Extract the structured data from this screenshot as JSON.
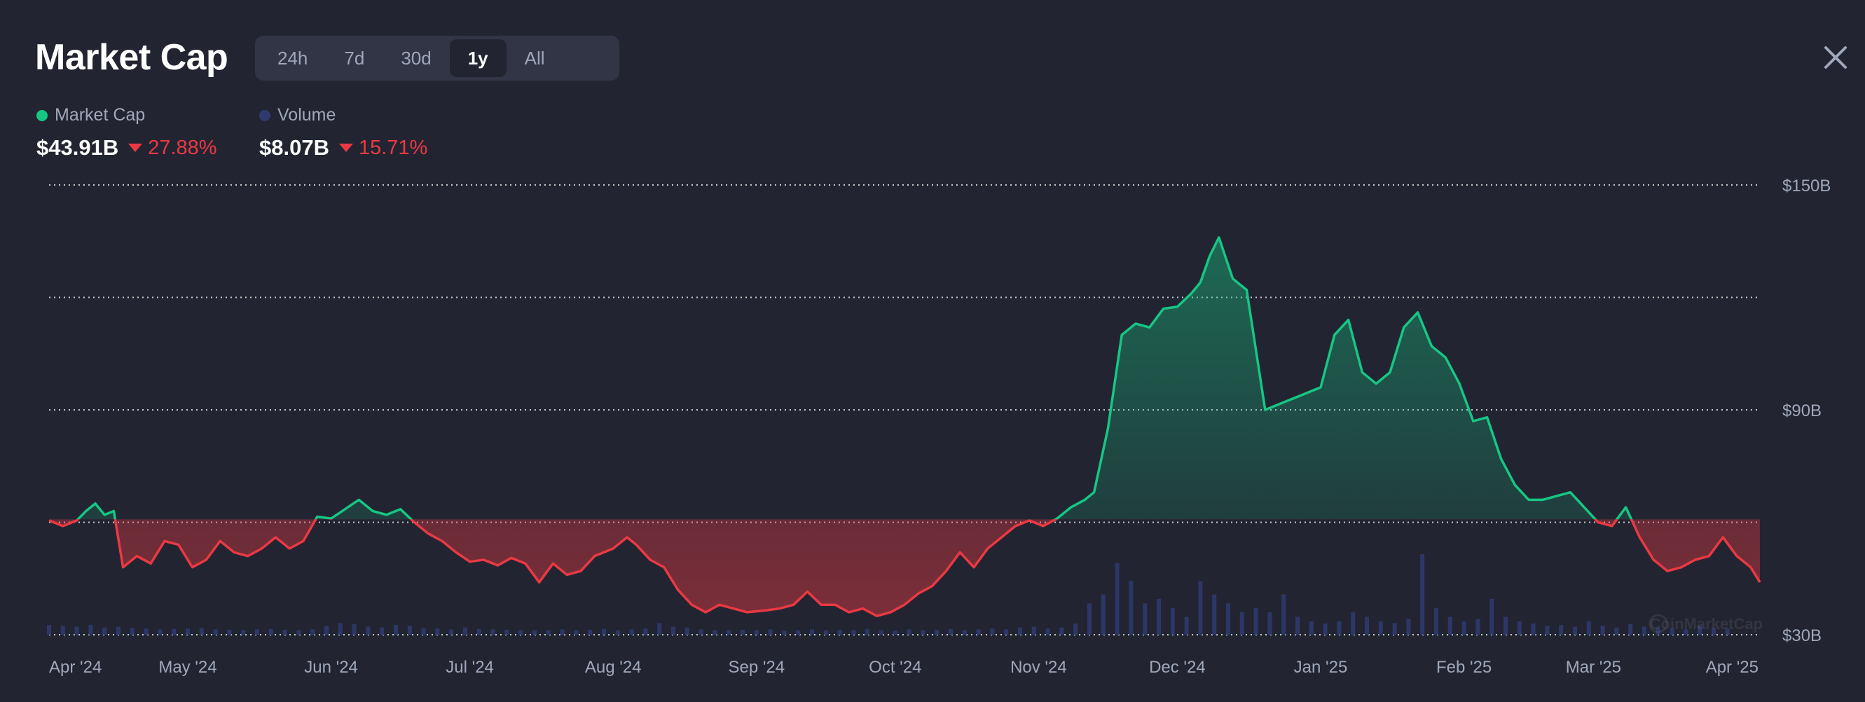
{
  "header": {
    "title": "Market Cap",
    "ranges": [
      "24h",
      "7d",
      "30d",
      "1y",
      "All"
    ],
    "active_range": "1y"
  },
  "legend": [
    {
      "label": "Market Cap",
      "color": "#16c784"
    },
    {
      "label": "Volume",
      "color": "#2f3a6e"
    }
  ],
  "stats": {
    "market_cap": {
      "value": "$43.91B",
      "change": "27.88%",
      "direction": "down"
    },
    "volume": {
      "value": "$8.07B",
      "change": "15.71%",
      "direction": "down"
    }
  },
  "colors": {
    "up": "#16c784",
    "down": "#ea3943",
    "background": "#222531",
    "volume": "#2f3a6e",
    "grid": "#ffffff"
  },
  "watermark": "CoinMarketCap",
  "chart_data": {
    "type": "area",
    "baseline": 60.8,
    "ylim": [
      30,
      150
    ],
    "yticks": [
      30,
      90,
      150
    ],
    "ytick_labels": [
      "$30B",
      "$90B",
      "$150B"
    ],
    "grid_lines": [
      30,
      60,
      90,
      120,
      150
    ],
    "x_start": "2024-04-01",
    "x_end": "2025-04-06",
    "xtick_dates": [
      "2024-04-01",
      "2024-05-01",
      "2024-06-01",
      "2024-07-01",
      "2024-08-01",
      "2024-09-01",
      "2024-10-01",
      "2024-11-01",
      "2024-12-01",
      "2025-01-01",
      "2025-02-01",
      "2025-03-01",
      "2025-04-01"
    ],
    "xtick_labels": [
      "Apr '24",
      "May '24",
      "Jun '24",
      "Jul '24",
      "Aug '24",
      "Sep '24",
      "Oct '24",
      "Nov '24",
      "Dec '24",
      "Jan '25",
      "Feb '25",
      "Mar '25",
      "Apr '25"
    ],
    "series": [
      {
        "name": "Market Cap",
        "x": [
          "2024-04-01",
          "2024-04-04",
          "2024-04-07",
          "2024-04-09",
          "2024-04-11",
          "2024-04-13",
          "2024-04-15",
          "2024-04-17",
          "2024-04-20",
          "2024-04-23",
          "2024-04-26",
          "2024-04-29",
          "2024-05-02",
          "2024-05-05",
          "2024-05-08",
          "2024-05-11",
          "2024-05-14",
          "2024-05-17",
          "2024-05-20",
          "2024-05-23",
          "2024-05-26",
          "2024-05-29",
          "2024-06-01",
          "2024-06-04",
          "2024-06-07",
          "2024-06-10",
          "2024-06-13",
          "2024-06-16",
          "2024-06-19",
          "2024-06-22",
          "2024-06-25",
          "2024-06-28",
          "2024-07-01",
          "2024-07-04",
          "2024-07-07",
          "2024-07-10",
          "2024-07-13",
          "2024-07-16",
          "2024-07-19",
          "2024-07-22",
          "2024-07-25",
          "2024-07-28",
          "2024-08-01",
          "2024-08-04",
          "2024-08-06",
          "2024-08-09",
          "2024-08-12",
          "2024-08-15",
          "2024-08-18",
          "2024-08-21",
          "2024-08-24",
          "2024-08-27",
          "2024-08-30",
          "2024-09-03",
          "2024-09-06",
          "2024-09-09",
          "2024-09-12",
          "2024-09-15",
          "2024-09-18",
          "2024-09-21",
          "2024-09-24",
          "2024-09-27",
          "2024-09-30",
          "2024-10-03",
          "2024-10-06",
          "2024-10-09",
          "2024-10-12",
          "2024-10-15",
          "2024-10-18",
          "2024-10-21",
          "2024-10-24",
          "2024-10-27",
          "2024-10-30",
          "2024-11-02",
          "2024-11-05",
          "2024-11-08",
          "2024-11-11",
          "2024-11-13",
          "2024-11-16",
          "2024-11-19",
          "2024-11-22",
          "2024-11-25",
          "2024-11-28",
          "2024-12-01",
          "2024-12-04",
          "2024-12-06",
          "2024-12-08",
          "2024-12-10",
          "2024-12-13",
          "2024-12-16",
          "2024-12-20",
          "2024-12-24",
          "2024-12-28",
          "2025-01-01",
          "2025-01-04",
          "2025-01-07",
          "2025-01-10",
          "2025-01-13",
          "2025-01-16",
          "2025-01-19",
          "2025-01-22",
          "2025-01-25",
          "2025-01-28",
          "2025-01-31",
          "2025-02-03",
          "2025-02-06",
          "2025-02-09",
          "2025-02-12",
          "2025-02-15",
          "2025-02-18",
          "2025-02-21",
          "2025-02-24",
          "2025-02-27",
          "2025-03-02",
          "2025-03-05",
          "2025-03-08",
          "2025-03-11",
          "2025-03-14",
          "2025-03-17",
          "2025-03-20",
          "2025-03-23",
          "2025-03-26",
          "2025-03-29",
          "2025-04-01",
          "2025-04-04",
          "2025-04-06"
        ],
        "values": [
          60.5,
          59.0,
          60.5,
          63.0,
          65.0,
          62.0,
          63.0,
          48.0,
          51.0,
          49.0,
          55.0,
          54.0,
          48.0,
          50.0,
          55.0,
          52.0,
          51.0,
          53.0,
          56.0,
          53.0,
          55.0,
          61.5,
          61.0,
          63.5,
          66.0,
          63.0,
          62.0,
          63.5,
          60.0,
          57.0,
          55.0,
          52.0,
          49.5,
          50.0,
          48.5,
          50.5,
          49.0,
          44.0,
          49.0,
          46.0,
          47.0,
          51.0,
          53.0,
          56.0,
          54.0,
          50.0,
          48.0,
          42.0,
          38.0,
          36.0,
          38.0,
          37.0,
          36.0,
          36.5,
          37.0,
          38.0,
          41.5,
          38.0,
          38.0,
          36.0,
          37.0,
          35.0,
          36.0,
          38.0,
          41.0,
          43.0,
          47.0,
          52.0,
          48.0,
          53.0,
          56.0,
          59.0,
          60.5,
          59.0,
          61.0,
          64.0,
          66.0,
          68.0,
          85.0,
          110.0,
          113.0,
          112.0,
          117.0,
          117.5,
          121.0,
          124.0,
          131.0,
          136.0,
          125.0,
          122.0,
          90.0,
          92.0,
          94.0,
          96.0,
          110.0,
          114.0,
          100.0,
          97.0,
          100.0,
          112.0,
          116.0,
          107.0,
          104.0,
          97.0,
          87.0,
          88.0,
          77.0,
          70.0,
          66.0,
          66.0,
          67.0,
          68.0,
          64.0,
          60.0,
          59.0,
          64.0,
          56.0,
          50.0,
          47.0,
          48.0,
          50.0,
          51.0,
          56.0,
          51.0,
          48.0,
          44.0
        ]
      },
      {
        "name": "Volume",
        "x_start": "2024-04-01",
        "step_days": 3,
        "values": [
          2.2,
          2.0,
          1.8,
          2.2,
          1.6,
          1.8,
          1.5,
          1.4,
          1.2,
          1.3,
          1.4,
          1.5,
          1.2,
          1.1,
          1.0,
          1.2,
          1.3,
          1.1,
          1.0,
          1.2,
          2.0,
          2.6,
          2.4,
          1.8,
          1.6,
          2.2,
          2.0,
          1.5,
          1.4,
          1.2,
          1.6,
          1.3,
          1.2,
          1.1,
          1.0,
          1.0,
          1.0,
          1.2,
          1.0,
          1.1,
          1.3,
          1.0,
          1.2,
          1.4,
          2.6,
          1.8,
          1.6,
          1.2,
          1.0,
          1.0,
          1.1,
          1.0,
          1.2,
          0.9,
          1.0,
          1.2,
          1.0,
          1.1,
          1.0,
          1.3,
          1.0,
          0.9,
          1.2,
          1.0,
          1.1,
          1.3,
          1.0,
          1.2,
          1.4,
          1.2,
          1.6,
          1.8,
          1.4,
          1.6,
          2.5,
          7.0,
          9.0,
          16.0,
          12.0,
          7.0,
          8.0,
          6.0,
          4.0,
          12.0,
          9.0,
          7.0,
          5.0,
          6.0,
          5.0,
          9.0,
          4.0,
          3.0,
          2.5,
          3.0,
          5.0,
          4.0,
          3.0,
          2.6,
          3.5,
          18.0,
          6.0,
          4.0,
          3.0,
          3.5,
          8.0,
          4.0,
          3.0,
          2.5,
          2.0,
          2.2,
          1.8,
          3.0,
          2.0,
          1.6,
          2.4,
          1.8,
          1.6,
          1.4,
          1.2,
          2.0,
          1.5,
          1.4
        ]
      }
    ]
  }
}
